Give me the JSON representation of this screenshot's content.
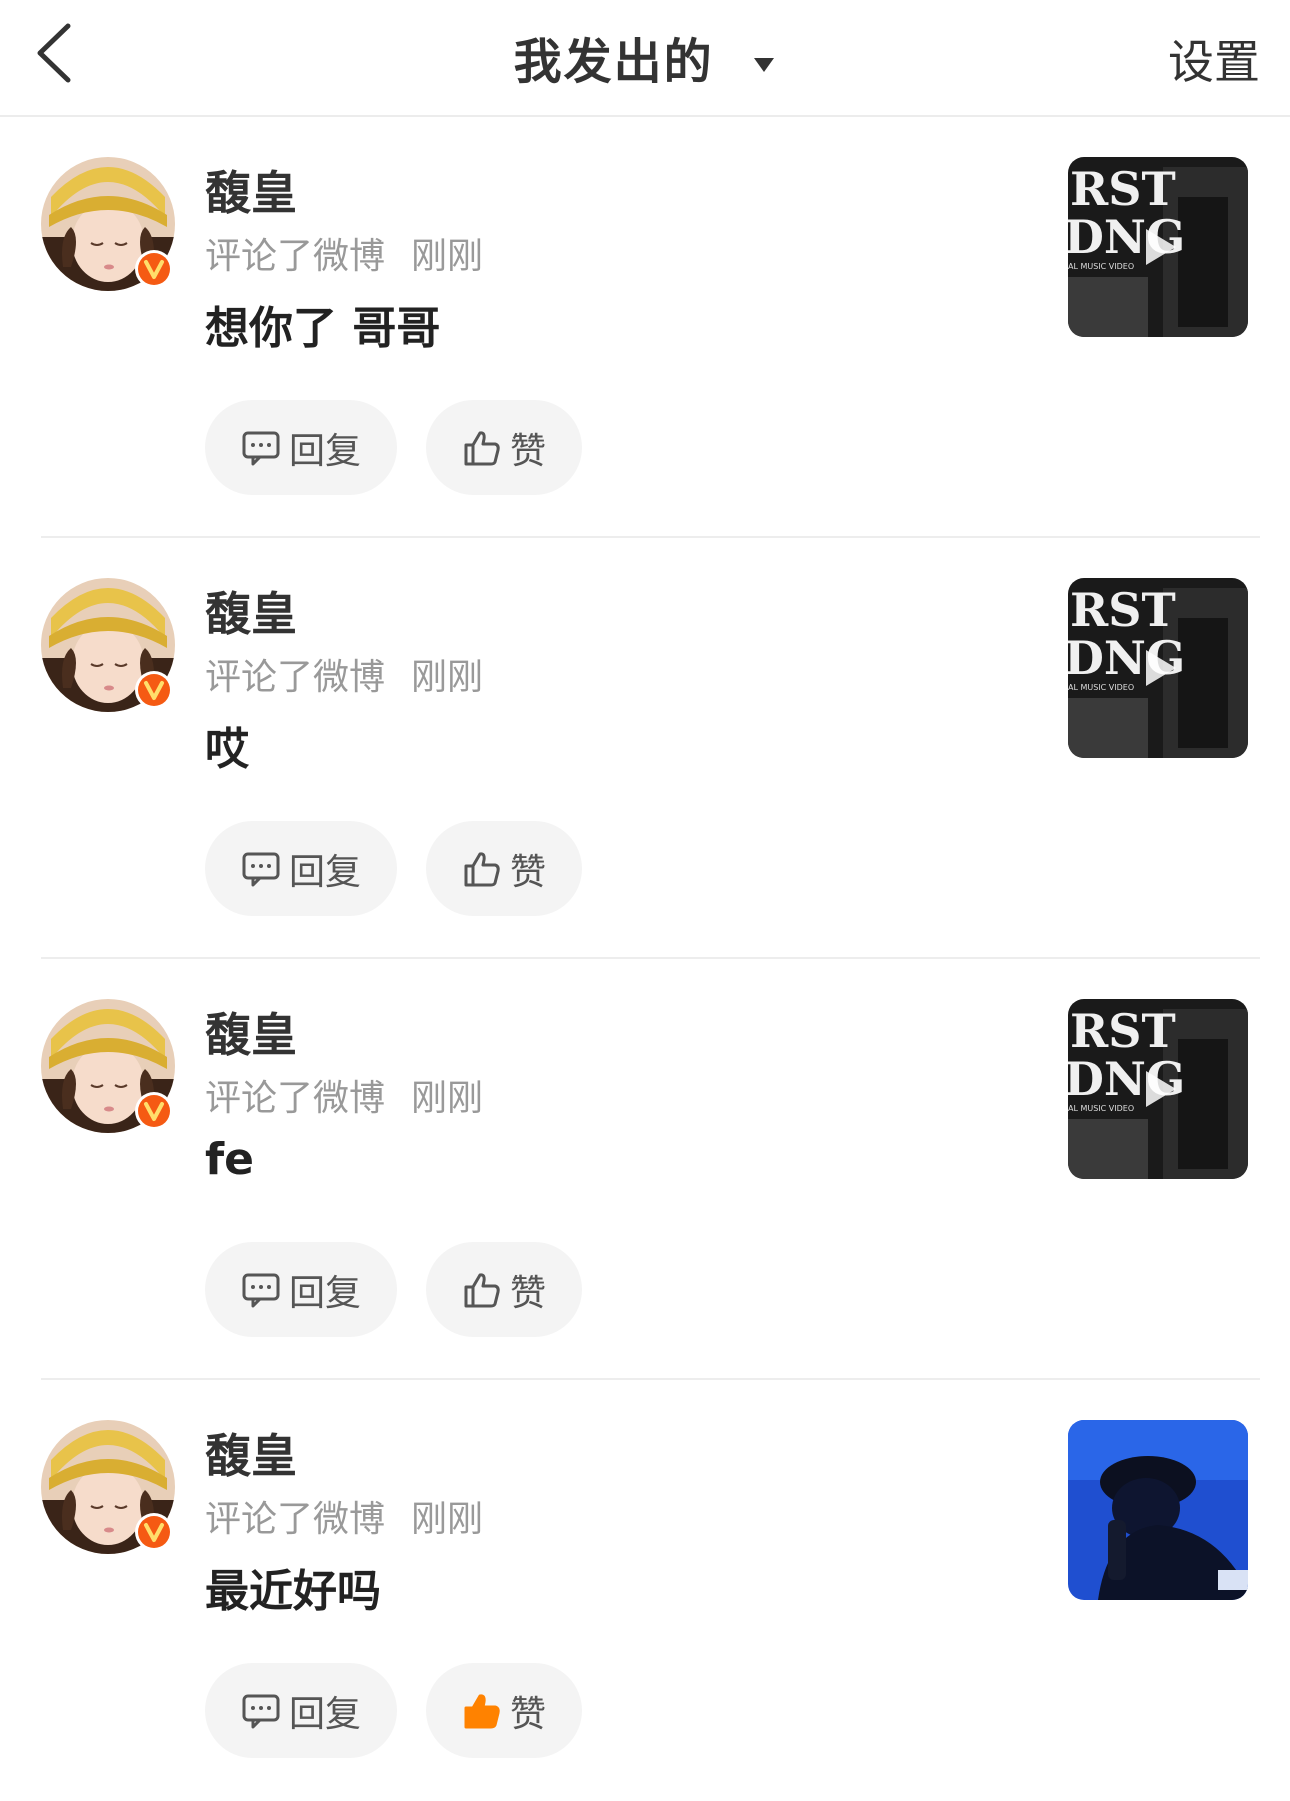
{
  "header": {
    "title": "我发出的",
    "settings": "设置"
  },
  "colors": {
    "accent": "#ff8200",
    "badge": "#f55a13"
  },
  "items": [
    {
      "username": "馥皇",
      "action": "评论了微博",
      "time": "刚刚",
      "content": "想你了 哥哥",
      "reply_label": "回复",
      "like_label": "赞",
      "liked": false,
      "thumb": "music-video-cover"
    },
    {
      "username": "馥皇",
      "action": "评论了微博",
      "time": "刚刚",
      "content": "哎",
      "reply_label": "回复",
      "like_label": "赞",
      "liked": false,
      "thumb": "music-video-cover"
    },
    {
      "username": "馥皇",
      "action": "评论了微博",
      "time": "刚刚",
      "content": "fe",
      "reply_label": "回复",
      "like_label": "赞",
      "liked": false,
      "thumb": "music-video-cover"
    },
    {
      "username": "馥皇",
      "action": "评论了微博",
      "time": "刚刚",
      "content": "最近好吗",
      "reply_label": "回复",
      "like_label": "赞",
      "liked": true,
      "thumb": "blue-portrait-cover"
    }
  ]
}
